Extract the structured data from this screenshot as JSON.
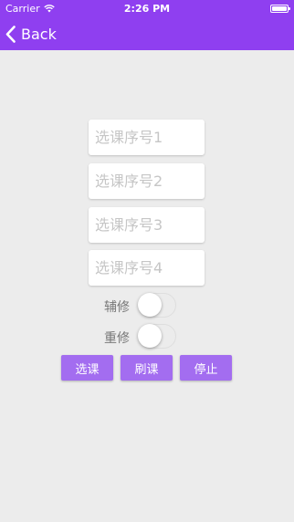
{
  "status_bar": {
    "carrier": "Carrier",
    "time": "2:26 PM"
  },
  "nav": {
    "back_label": "Back"
  },
  "colors": {
    "accent": "#8f3ff0",
    "button": "#a36df0",
    "background": "#ececec"
  },
  "form": {
    "fields": [
      {
        "placeholder": "选课序号1",
        "value": ""
      },
      {
        "placeholder": "选课序号2",
        "value": ""
      },
      {
        "placeholder": "选课序号3",
        "value": ""
      },
      {
        "placeholder": "选课序号4",
        "value": ""
      }
    ],
    "switches": [
      {
        "label": "辅修",
        "on": false
      },
      {
        "label": "重修",
        "on": false
      }
    ]
  },
  "actions": {
    "select_label": "选课",
    "refresh_label": "刷课",
    "stop_label": "停止"
  }
}
